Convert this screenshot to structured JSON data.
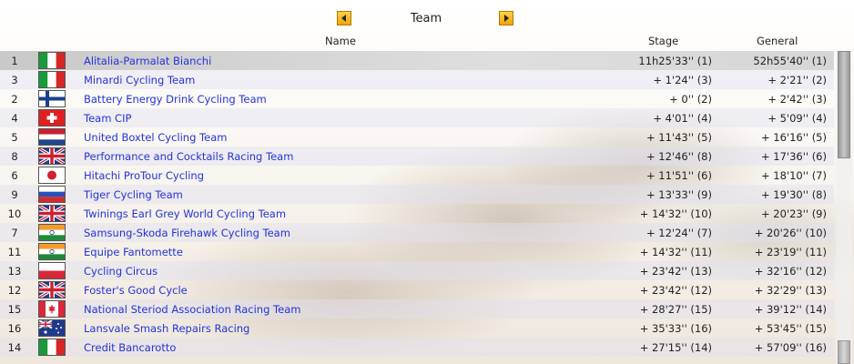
{
  "header": {
    "title": "Team",
    "prev_icon": "arrow-left-icon",
    "next_icon": "arrow-right-icon"
  },
  "columns": {
    "name": "Name",
    "stage": "Stage",
    "general": "General"
  },
  "colors": {
    "team_link": "#2233dd",
    "selected_row": "#cccccc",
    "nav_button": "#f2a400"
  },
  "rows": [
    {
      "rank": "1",
      "flag": "italy",
      "name": "Alitalia-Parmalat Bianchi",
      "stage": "11h25'33'' (1)",
      "general": "52h55'40'' (1)"
    },
    {
      "rank": "3",
      "flag": "italy",
      "name": "Minardi Cycling Team",
      "stage": "+ 1'24'' (3)",
      "general": "+ 2'21'' (2)"
    },
    {
      "rank": "2",
      "flag": "finland",
      "name": "Battery Energy Drink Cycling Team",
      "stage": "+ 0'' (2)",
      "general": "+ 2'42'' (3)"
    },
    {
      "rank": "4",
      "flag": "switzerland",
      "name": "Team CIP",
      "stage": "+ 4'01'' (4)",
      "general": "+ 5'09'' (4)"
    },
    {
      "rank": "5",
      "flag": "netherlands",
      "name": "United Boxtel Cycling Team",
      "stage": "+ 11'43'' (5)",
      "general": "+ 16'16'' (5)"
    },
    {
      "rank": "8",
      "flag": "uk",
      "name": "Performance and Cocktails Racing Team",
      "stage": "+ 12'46'' (8)",
      "general": "+ 17'36'' (6)"
    },
    {
      "rank": "6",
      "flag": "japan",
      "name": "Hitachi ProTour Cycling",
      "stage": "+ 11'51'' (6)",
      "general": "+ 18'10'' (7)"
    },
    {
      "rank": "9",
      "flag": "russia",
      "name": "Tiger Cycling Team",
      "stage": "+ 13'33'' (9)",
      "general": "+ 19'30'' (8)"
    },
    {
      "rank": "10",
      "flag": "uk",
      "name": "Twinings Earl Grey World Cycling Team",
      "stage": "+ 14'32'' (10)",
      "general": "+ 20'23'' (9)"
    },
    {
      "rank": "7",
      "flag": "india",
      "name": "Samsung-Skoda Firehawk Cycling Team",
      "stage": "+ 12'24'' (7)",
      "general": "+ 20'26'' (10)"
    },
    {
      "rank": "11",
      "flag": "india",
      "name": "Equipe Fantomette",
      "stage": "+ 14'32'' (11)",
      "general": "+ 23'19'' (11)"
    },
    {
      "rank": "13",
      "flag": "poland",
      "name": "Cycling Circus",
      "stage": "+ 23'42'' (13)",
      "general": "+ 32'16'' (12)"
    },
    {
      "rank": "12",
      "flag": "uk",
      "name": "Foster's Good Cycle",
      "stage": "+ 23'42'' (12)",
      "general": "+ 32'29'' (13)"
    },
    {
      "rank": "15",
      "flag": "canada",
      "name": "National Steriod Association Racing Team",
      "stage": "+ 28'27'' (15)",
      "general": "+ 39'12'' (14)"
    },
    {
      "rank": "16",
      "flag": "australia",
      "name": "Lansvale Smash Repairs Racing",
      "stage": "+ 35'33'' (16)",
      "general": "+ 53'45'' (15)"
    },
    {
      "rank": "14",
      "flag": "italy",
      "name": "Credit Bancarotto",
      "stage": "+ 27'15'' (14)",
      "general": "+ 57'09'' (16)"
    }
  ]
}
